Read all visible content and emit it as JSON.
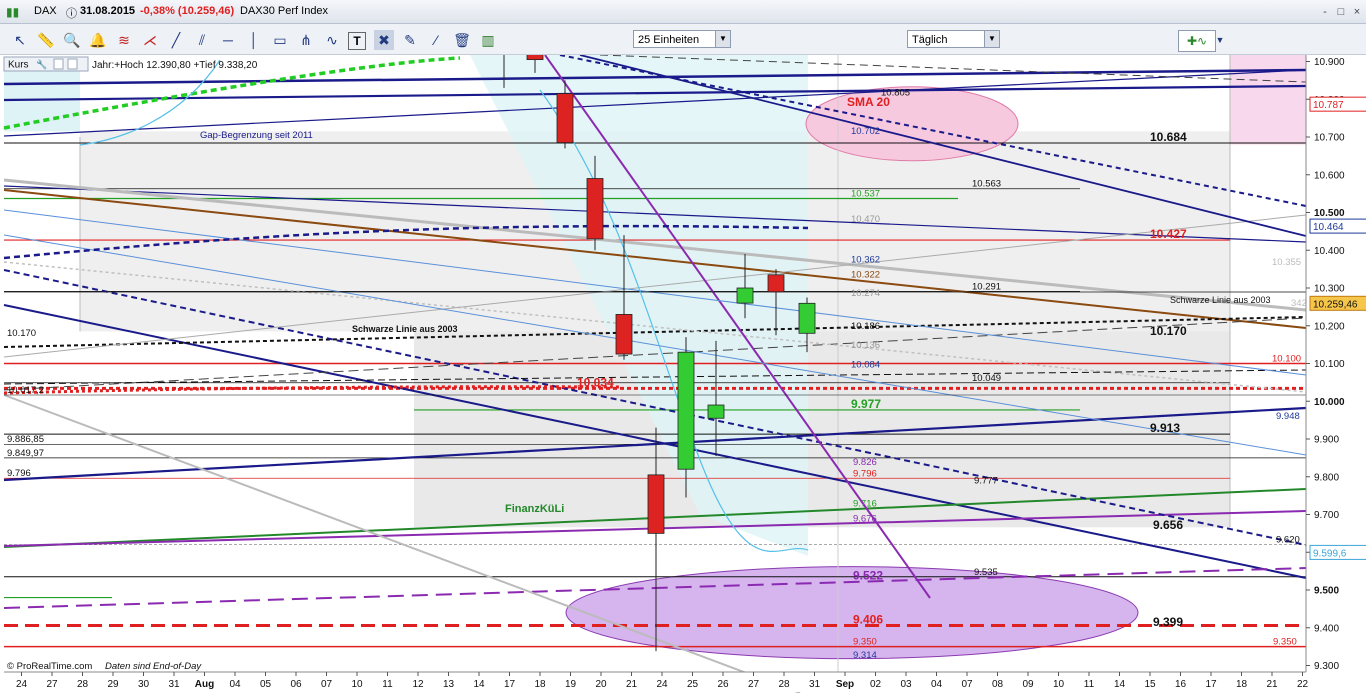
{
  "titlebar": {
    "instrument": "DAX",
    "date": "31.08.2015",
    "change": "-0,38% (10.259,46)",
    "name": "DAX30 Perf Index",
    "window_buttons": [
      "-",
      "□",
      "×"
    ]
  },
  "toolbar": {
    "units_label": "25 Einheiten",
    "period_label": "Täglich",
    "tools": [
      "pointer-icon",
      "ruler-icon",
      "zoom-icon",
      "alarm-icon",
      "fibonacci-icon",
      "fan-icon",
      "trendline-icon",
      "channel-icon",
      "horizontal-line-icon",
      "vertical-line-icon",
      "rectangle-icon",
      "pitchfork-icon",
      "wave-icon",
      "text-icon",
      "tools-icon",
      "pencil-icon",
      "brush-icon",
      "trash-icon",
      "bars-icon"
    ]
  },
  "legend": {
    "kurs_label": "Kurs",
    "info": "Jahr:+Hoch 12.390,80 +Tief 9.338,20"
  },
  "footer": {
    "brand": "© ProRealTime.com",
    "note": "Daten sind End-of-Day"
  },
  "chart_data": {
    "type": "candlestick",
    "ylim": [
      9300,
      10920
    ],
    "yticks": [
      "10.900",
      "10.800",
      "10.700",
      "10.600",
      "10.500",
      "10.400",
      "10.300",
      "10.200",
      "10.100",
      "10.000",
      "9.900",
      "9.800",
      "9.700",
      "9.600",
      "9.500",
      "9.400",
      "9.300"
    ],
    "xticks": [
      "24",
      "27",
      "28",
      "29",
      "30",
      "31",
      "Aug",
      "04",
      "05",
      "06",
      "07",
      "10",
      "11",
      "12",
      "13",
      "14",
      "17",
      "18",
      "19",
      "20",
      "21",
      "24",
      "25",
      "26",
      "27",
      "28",
      "31",
      "Sep",
      "02",
      "03",
      "04",
      "07",
      "08",
      "09",
      "10",
      "11",
      "14",
      "15",
      "16",
      "17",
      "18",
      "21",
      "22"
    ],
    "candles": [
      {
        "date": "17.08.2015",
        "open": 10940,
        "high": 10960,
        "low": 10830,
        "close": 10925
      },
      {
        "date": "18.08.2015",
        "open": 10920,
        "high": 10940,
        "low": 10870,
        "close": 10905
      },
      {
        "date": "19.08.2015",
        "open": 10815,
        "high": 10850,
        "low": 10670,
        "close": 10685
      },
      {
        "date": "20.08.2015",
        "open": 10590,
        "high": 10650,
        "low": 10400,
        "close": 10430
      },
      {
        "date": "21.08.2015",
        "open": 10230,
        "high": 10440,
        "low": 10110,
        "close": 10125
      },
      {
        "date": "24.08.2015",
        "open": 9805,
        "high": 9930,
        "low": 9338,
        "close": 9650
      },
      {
        "date": "25.08.2015",
        "open": 9820,
        "high": 10170,
        "low": 9745,
        "close": 10130
      },
      {
        "date": "26.08.2015",
        "open": 9955,
        "high": 10160,
        "low": 9855,
        "close": 9990
      },
      {
        "date": "27.08.2015",
        "open": 10260,
        "high": 10390,
        "low": 10220,
        "close": 10300
      },
      {
        "date": "28.08.2015",
        "open": 10335,
        "high": 10350,
        "low": 10175,
        "close": 10290
      },
      {
        "date": "31.08.2015",
        "open": 10180,
        "high": 10275,
        "low": 10130,
        "close": 10259.46
      }
    ],
    "price_badges": [
      {
        "value": "10.787",
        "color": "#e02020"
      },
      {
        "value": "10.464",
        "color": "#1e3a9a"
      },
      {
        "value": "10.259,46",
        "color": "#c07a10"
      },
      {
        "value": "9.599,6",
        "color": "#3aa6d8"
      }
    ],
    "level_labels": [
      {
        "text": "10.805",
        "value": 10805,
        "color": "#111111"
      },
      {
        "text": "SMA 20",
        "value": 10777,
        "color": "#e02020"
      },
      {
        "text": "10.702",
        "value": 10702,
        "color": "#1e3a9a"
      },
      {
        "text": "10.684",
        "value": 10684,
        "color": "#111111"
      },
      {
        "text": "10.563",
        "value": 10563,
        "color": "#111111"
      },
      {
        "text": "10.537",
        "value": 10537,
        "color": "#22a022"
      },
      {
        "text": "10.470",
        "value": 10470,
        "color": "#999999"
      },
      {
        "text": "10.427",
        "value": 10427,
        "color": "#e02020"
      },
      {
        "text": "10.362",
        "value": 10362,
        "color": "#1e3a9a"
      },
      {
        "text": "10.355",
        "value": 10355,
        "color": "#bbbbbb"
      },
      {
        "text": "10.322",
        "value": 10322,
        "color": "#8a4a10"
      },
      {
        "text": "10.291",
        "value": 10291,
        "color": "#111111"
      },
      {
        "text": "10.274",
        "value": 10274,
        "color": "#999999"
      },
      {
        "text": "10.186",
        "value": 10186,
        "color": "#111111"
      },
      {
        "text": "10.170",
        "value": 10170,
        "color": "#111111"
      },
      {
        "text": "10.136",
        "value": 10136,
        "color": "#999999"
      },
      {
        "text": "10.100",
        "value": 10100,
        "color": "#e02020"
      },
      {
        "text": "10.084",
        "value": 10084,
        "color": "#1e3a9a"
      },
      {
        "text": "10.049",
        "value": 10049,
        "color": "#111111"
      },
      {
        "text": "10.034",
        "value": 10034,
        "color": "#e02020"
      },
      {
        "text": "10.017,2",
        "value": 10017,
        "color": "#111111"
      },
      {
        "text": "9.977",
        "value": 9977,
        "color": "#22a022"
      },
      {
        "text": "9.948",
        "value": 9948,
        "color": "#1e3a9a"
      },
      {
        "text": "9.913",
        "value": 9913,
        "color": "#111111"
      },
      {
        "text": "9.886,85",
        "value": 9887,
        "color": "#111111"
      },
      {
        "text": "9.849,97",
        "value": 9850,
        "color": "#111111"
      },
      {
        "text": "9.826",
        "value": 9826,
        "color": "#8a2ab0"
      },
      {
        "text": "9.796",
        "value": 9796,
        "color": "#e02020"
      },
      {
        "text": "9.777",
        "value": 9777,
        "color": "#111111"
      },
      {
        "text": "9.716",
        "value": 9716,
        "color": "#22a022"
      },
      {
        "text": "9.676",
        "value": 9676,
        "color": "#8a2ab0"
      },
      {
        "text": "9.656",
        "value": 9656,
        "color": "#111111"
      },
      {
        "text": "9.620",
        "value": 9620,
        "color": "#111111"
      },
      {
        "text": "9.535",
        "value": 9535,
        "color": "#111111"
      },
      {
        "text": "9.522",
        "value": 9522,
        "color": "#8a2ab0"
      },
      {
        "text": "9.406",
        "value": 9406,
        "color": "#e02020"
      },
      {
        "text": "9.399",
        "value": 9399,
        "color": "#111111"
      },
      {
        "text": "9.350",
        "value": 9350,
        "color": "#e02020"
      },
      {
        "text": "9.314",
        "value": 9314,
        "color": "#1e3a9a"
      }
    ],
    "annotations": {
      "gap": "Gap-Begrenzung seit 2011",
      "schwarze_left": "Schwarze Linie aus 2003",
      "schwarze_right": "Schwarze Linie aus 2003",
      "finanz": "FinanzKüLi",
      "left_10170": "10.170",
      "left_796": "9.796",
      "right_342": "342"
    },
    "colors": {
      "bull": "#33cc33",
      "bear": "#dd2222",
      "axis": "#555555"
    }
  }
}
